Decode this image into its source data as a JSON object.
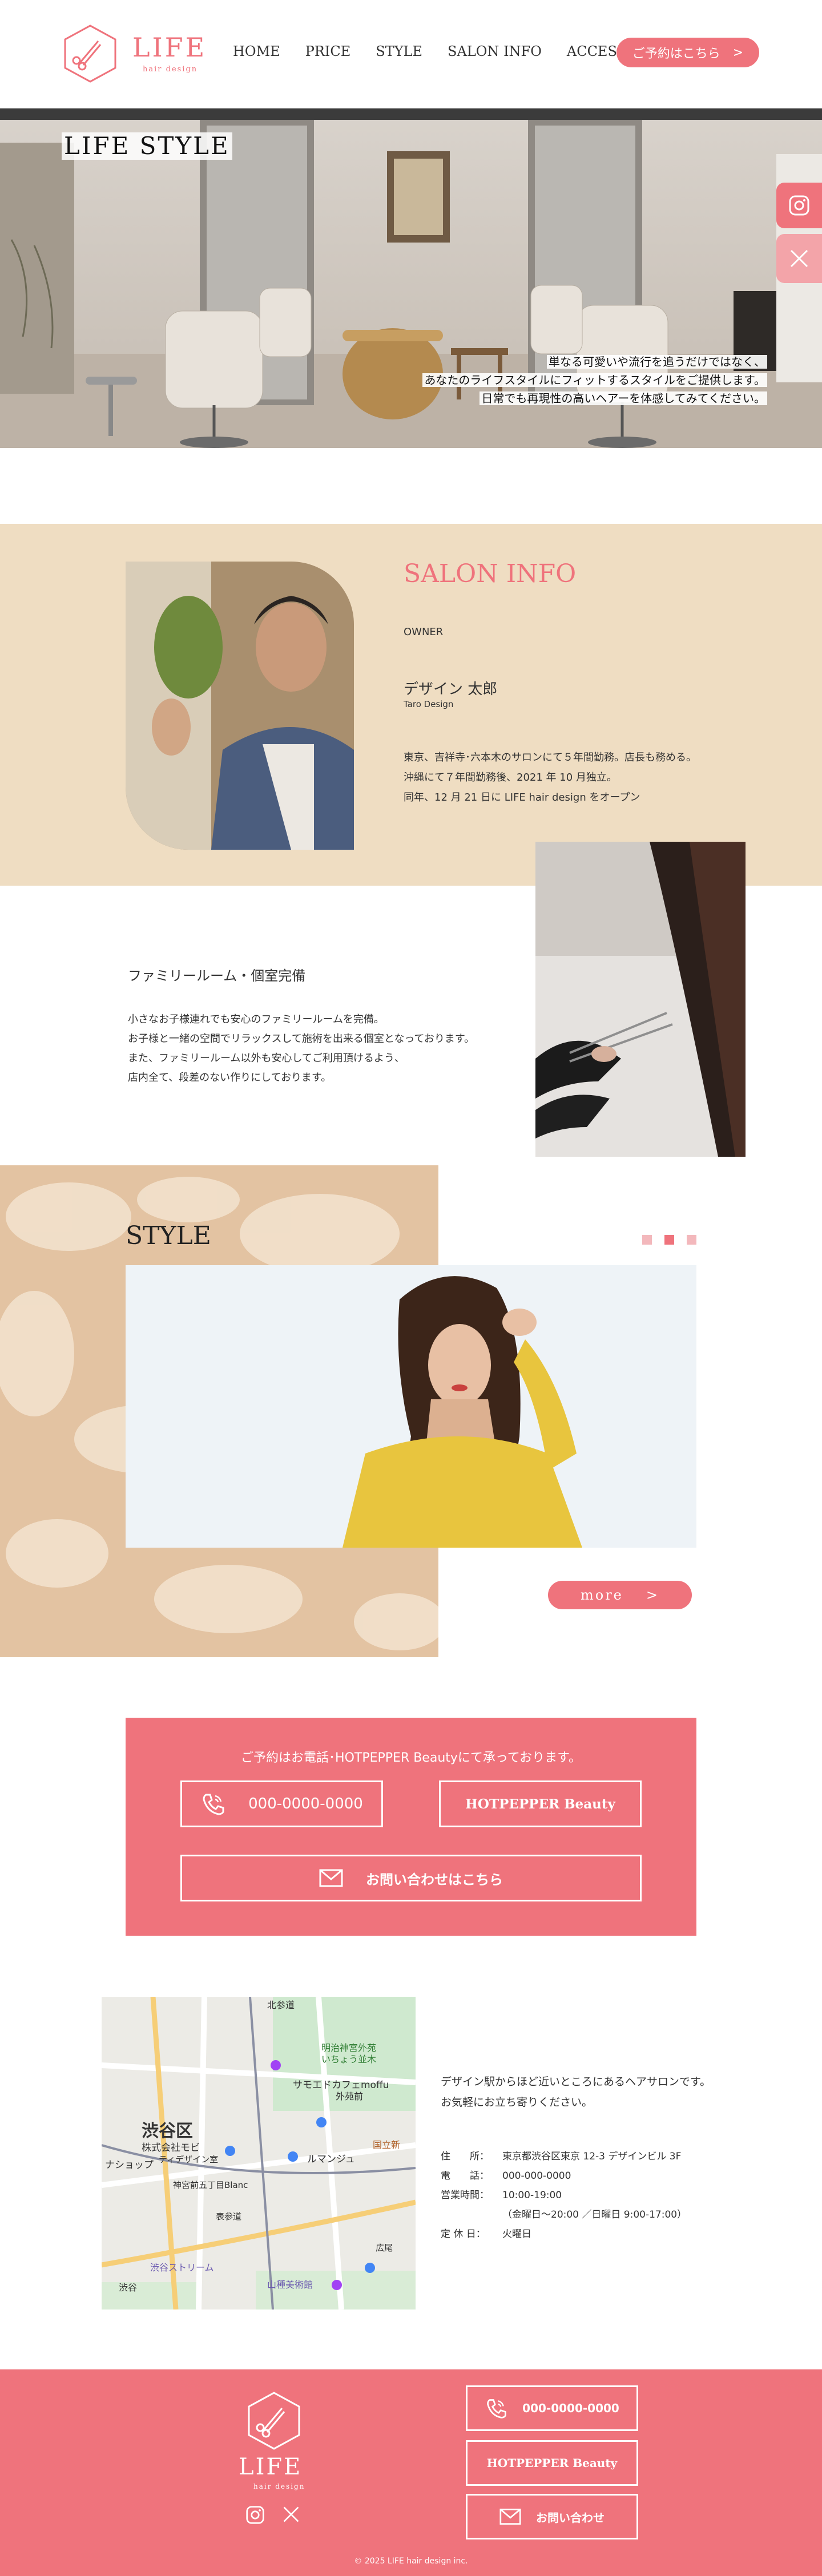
{
  "header": {
    "logo_text": "LIFE",
    "logo_sub": "hair design",
    "nav": [
      "HOME",
      "PRICE",
      "STYLE",
      "SALON INFO",
      "ACCESS"
    ],
    "reserve_label": "ご予約はこちら",
    "reserve_arrow": ">"
  },
  "hero": {
    "title": "LIFE  STYLE",
    "lines": [
      "単なる可愛いや流行を追うだけではなく、",
      "あなたのライフスタイルにフィットするスタイルをご提供します。",
      "日常でも再現性の高いヘアーを体感してみてください。"
    ]
  },
  "salon": {
    "title": "SALON INFO",
    "owner_label": "OWNER",
    "owner_name": "デザイン 太郎",
    "owner_roman": "Taro Design",
    "bio": [
      "東京、吉祥寺･六本木のサロンにて５年間勤務。店長も務める。",
      "沖縄にて７年間勤務後、2021 年 10 月独立。",
      "同年、12 月 21 日に LIFE hair design をオープン"
    ],
    "family_title": "ファミリールーム・個室完備",
    "family_text": [
      "小さなお子様連れでも安心のファミリールームを完備。",
      "お子様と一緒の空間でリラックスして施術を出来る個室となっております。",
      "また、ファミリールーム以外も安心してご利用頂けるよう、",
      "店内全て、段差のない作りにしております。"
    ]
  },
  "style": {
    "title": "STYLE",
    "more_label": "more",
    "more_arrow": ">"
  },
  "contact": {
    "lead": "ご予約はお電話･HOTPEPPER Beautyにて承っております。",
    "tel": "000-0000-0000",
    "hotpepper": "HOTPEPPER Beauty",
    "mail": "お問い合わせはこちら"
  },
  "map": {
    "labels": [
      "渋谷区",
      "株式会社モビ",
      "ナショップ",
      "ティデザイン室",
      "サモエドカフェmoffu",
      "明治神宮外苑",
      "いちょう並木",
      "外苑前",
      "北参道",
      "国立新",
      "ルマンジュ",
      "神宮前五丁目Blanc",
      "渋谷ストリーム",
      "広尾",
      "渋谷",
      "山種美術館",
      "表参道"
    ]
  },
  "access": {
    "lead": [
      "デザイン駅からほど近いところにあるヘアサロンです。",
      "お気軽にお立ち寄りください。"
    ],
    "rows": [
      {
        "k": "住　　所：",
        "v": "東京都渋谷区東京 12-3 デザインビル 3F"
      },
      {
        "k": "電　　話：",
        "v": "000-000-0000"
      },
      {
        "k": "営業時間：",
        "v": "10:00-19:00"
      },
      {
        "k": "",
        "v": "（金曜日～20:00 ／日曜日 9:00-17:00）"
      },
      {
        "k": "定 休 日：",
        "v": "火曜日"
      }
    ]
  },
  "footer": {
    "logo_text": "LIFE",
    "logo_sub": "hair design",
    "tel": "000-0000-0000",
    "hotpepper": "HOTPEPPER Beauty",
    "mail": "お問い合わせ",
    "copyright": "© 2025 LIFE hair design inc."
  },
  "colors": {
    "accent": "#EF737C",
    "beige": "#EFDDC2"
  }
}
